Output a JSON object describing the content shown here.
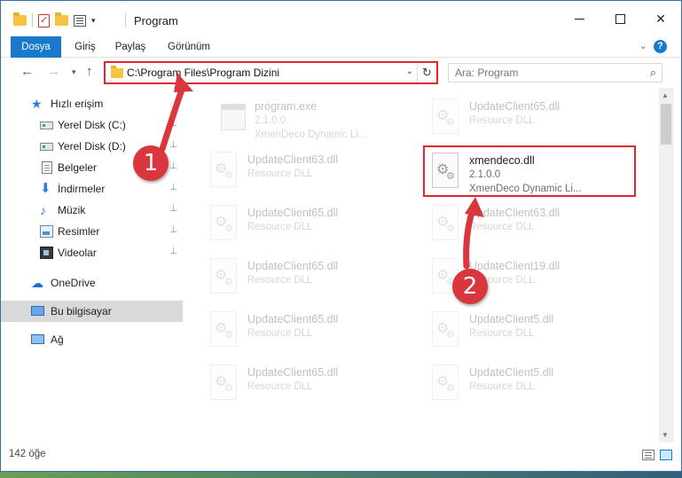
{
  "window": {
    "title": "Program",
    "buttons": {
      "minimize": "minimize",
      "maximize": "maximize",
      "close": "✕"
    }
  },
  "ribbon": {
    "tabs": [
      "Dosya",
      "Giriş",
      "Paylaş",
      "Görünüm"
    ],
    "help": "?"
  },
  "navbar": {
    "back": "←",
    "forward": "→",
    "recent": "▾",
    "up": "↑",
    "address_path": "C:\\Program Files\\Program Dizini",
    "dropdown": "⌄",
    "refresh": "↻",
    "search_placeholder": "Ara: Program",
    "search_icon": "⌕"
  },
  "sidebar": {
    "items": [
      {
        "label": "Hızlı erişim",
        "icon": "star-icon"
      },
      {
        "label": "Yerel Disk (C:)",
        "icon": "drive-icon",
        "pinned": true
      },
      {
        "label": "Yerel Disk (D:)",
        "icon": "drive-icon",
        "pinned": true
      },
      {
        "label": "Belgeler",
        "icon": "document-icon",
        "pinned": true
      },
      {
        "label": "İndirmeler",
        "icon": "download-icon",
        "pinned": true
      },
      {
        "label": "Müzik",
        "icon": "music-icon",
        "pinned": true
      },
      {
        "label": "Resimler",
        "icon": "pictures-icon",
        "pinned": true
      },
      {
        "label": "Videolar",
        "icon": "video-icon",
        "pinned": true
      },
      {
        "label": "OneDrive",
        "icon": "cloud-icon"
      },
      {
        "label": "Bu bilgisayar",
        "icon": "computer-icon",
        "selected": true
      },
      {
        "label": "Ağ",
        "icon": "network-icon"
      }
    ],
    "pin_glyph": "📌"
  },
  "files": [
    {
      "name": "program.exe",
      "line2": "2.1.0.0",
      "line3": "XmenDeco Dynamic Li...",
      "type": "exe",
      "faded": true
    },
    {
      "name": "UpdateClient65.dll",
      "line2": "Resource DLL",
      "line3": "",
      "type": "dll",
      "faded": true
    },
    {
      "name": "UpdateClient63.dll",
      "line2": "Resource DLL",
      "line3": "",
      "type": "dll",
      "faded": true
    },
    {
      "name": "xmendeco.dll",
      "line2": "2.1.0.0",
      "line3": "XmenDeco Dynamic Li...",
      "type": "dll",
      "faded": false,
      "highlight": true
    },
    {
      "name": "UpdateClient65.dll",
      "line2": "Resource DLL",
      "line3": "",
      "type": "dll",
      "faded": true
    },
    {
      "name": "UpdateClient63.dll",
      "line2": "Resource DLL",
      "line3": "",
      "type": "dll",
      "faded": true
    },
    {
      "name": "UpdateClient65.dll",
      "line2": "Resource DLL",
      "line3": "",
      "type": "dll",
      "faded": true
    },
    {
      "name": "UpdateClient19.dll",
      "line2": "Resource DLL",
      "line3": "",
      "type": "dll",
      "faded": true
    },
    {
      "name": "UpdateClient65.dll",
      "line2": "Resource DLL",
      "line3": "",
      "type": "dll",
      "faded": true
    },
    {
      "name": "UpdateClient5.dll",
      "line2": "Resource DLL",
      "line3": "",
      "type": "dll",
      "faded": true
    },
    {
      "name": "UpdateClient65.dll",
      "line2": "Resource DLL",
      "line3": "",
      "type": "dll",
      "faded": true
    },
    {
      "name": "UpdateClient5.dll",
      "line2": "Resource DLL",
      "line3": "",
      "type": "dll",
      "faded": true
    }
  ],
  "statusbar": {
    "item_count": "142 öğe"
  },
  "annotations": {
    "step1": "1",
    "step2": "2",
    "color": "#d9363e"
  },
  "colors": {
    "accent": "#1979ca",
    "highlight_border": "#e0262f",
    "selected_bg": "#d9d9d9"
  }
}
